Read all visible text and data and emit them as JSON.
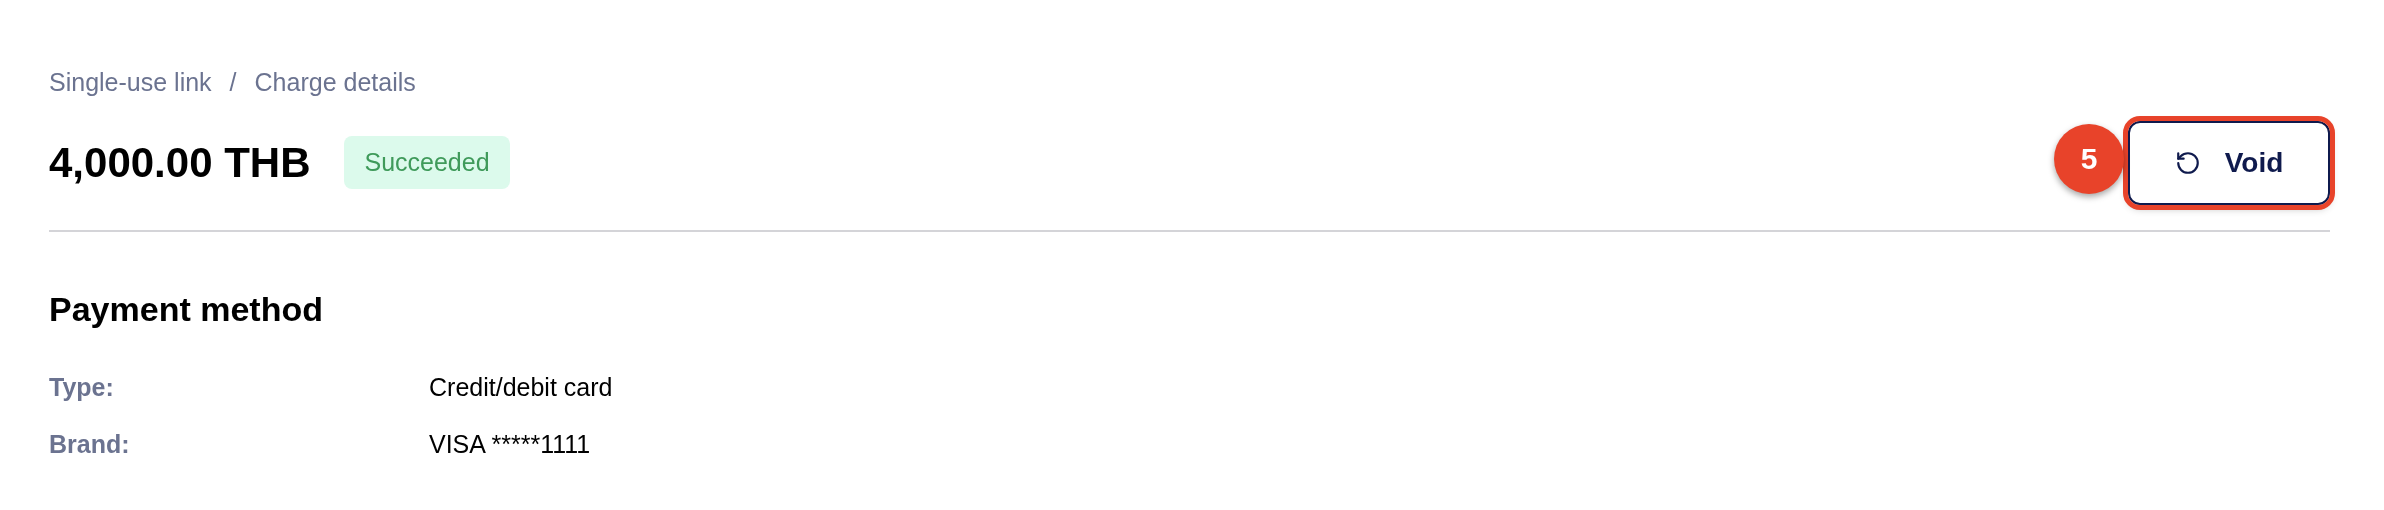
{
  "breadcrumb": [
    "Single-use link",
    "Charge details"
  ],
  "breadcrumb_separator": "/",
  "amount": "4,000.00 THB",
  "status": {
    "label": "Succeeded",
    "kind": "success"
  },
  "step_marker": "5",
  "void_button": {
    "label": "Void",
    "highlighted": true
  },
  "payment_method": {
    "title": "Payment method",
    "fields": [
      {
        "label": "Type:",
        "value": "Credit/debit card"
      },
      {
        "label": "Brand:",
        "value": "VISA *****1111"
      }
    ]
  }
}
